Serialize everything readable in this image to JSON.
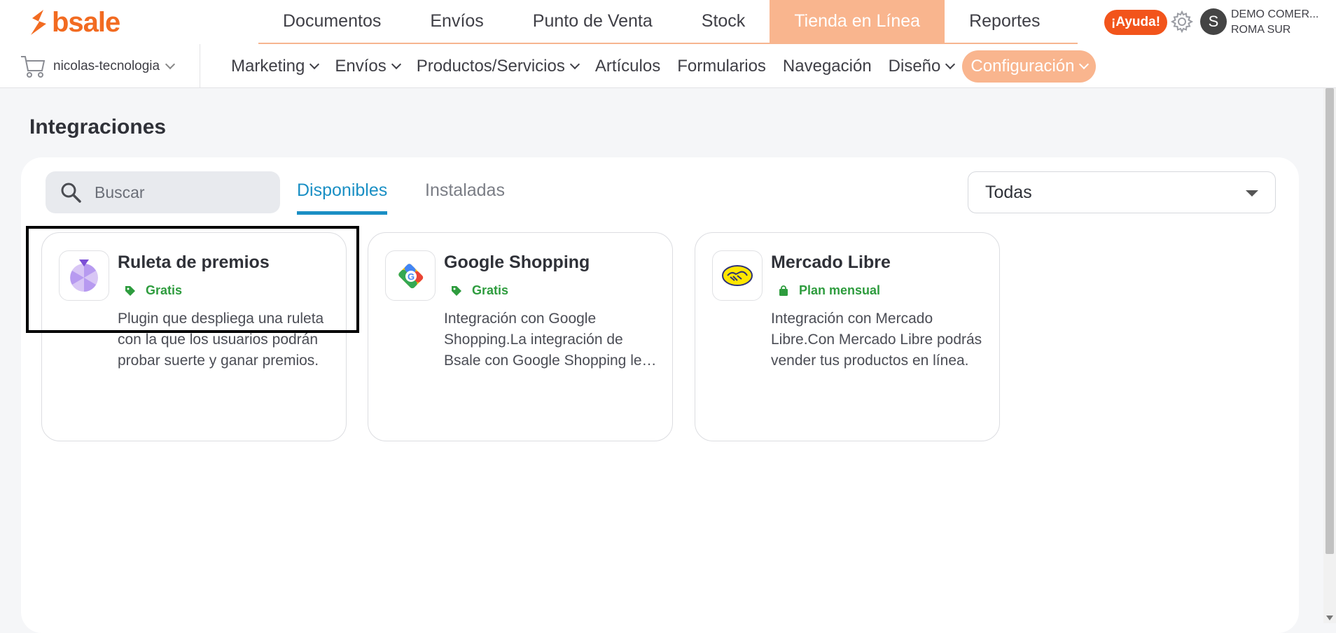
{
  "brand": {
    "name": "bsale",
    "color": "#f26b21"
  },
  "main_nav": [
    {
      "label": "Documentos",
      "active": false
    },
    {
      "label": "Envíos",
      "active": false
    },
    {
      "label": "Punto de Venta",
      "active": false
    },
    {
      "label": "Stock",
      "active": false
    },
    {
      "label": "Tienda en Línea",
      "active": true
    },
    {
      "label": "Reportes",
      "active": false
    }
  ],
  "header": {
    "help_label": "¡Ayuda!",
    "avatar_initial": "S",
    "company_line1": "DEMO COMER...",
    "company_line2": "ROMA SUR"
  },
  "store_selector": {
    "label": "nicolas-tecnologia"
  },
  "sub_nav": [
    {
      "label": "Marketing",
      "has_dropdown": true,
      "active": false
    },
    {
      "label": "Envíos",
      "has_dropdown": true,
      "active": false
    },
    {
      "label": "Productos/Servicios",
      "has_dropdown": true,
      "active": false
    },
    {
      "label": "Artículos",
      "has_dropdown": false,
      "active": false
    },
    {
      "label": "Formularios",
      "has_dropdown": false,
      "active": false
    },
    {
      "label": "Navegación",
      "has_dropdown": false,
      "active": false
    },
    {
      "label": "Diseño",
      "has_dropdown": true,
      "active": false
    },
    {
      "label": "Configuración",
      "has_dropdown": true,
      "active": true
    }
  ],
  "page": {
    "title": "Integraciones",
    "search_placeholder": "Buscar",
    "tabs": {
      "available": "Disponibles",
      "installed": "Instaladas"
    },
    "filter_value": "Todas"
  },
  "cards": [
    {
      "title": "Ruleta de premios",
      "price": "Gratis",
      "price_icon": "tag-icon",
      "description": "Plugin que despliega una ruleta con la que los usuarios podrán probar suerte y ganar premios.",
      "icon": "roulette-icon"
    },
    {
      "title": "Google Shopping",
      "price": "Gratis",
      "price_icon": "tag-icon",
      "description": "Integración con Google Shopping.La integración de Bsale con Google Shopping le permitirá mostrar sus productos.",
      "icon": "google-shopping-icon"
    },
    {
      "title": "Mercado Libre",
      "price": "Plan mensual",
      "price_icon": "bag-icon",
      "description": "Integración con Mercado Libre.Con Mercado Libre podrás vender tus productos en línea.",
      "icon": "mercado-libre-icon"
    }
  ],
  "colors": {
    "accent": "#f9b58e",
    "tab_active": "#1a8fc4",
    "price_green": "#2e9c3e",
    "help_red": "#f2541b"
  }
}
